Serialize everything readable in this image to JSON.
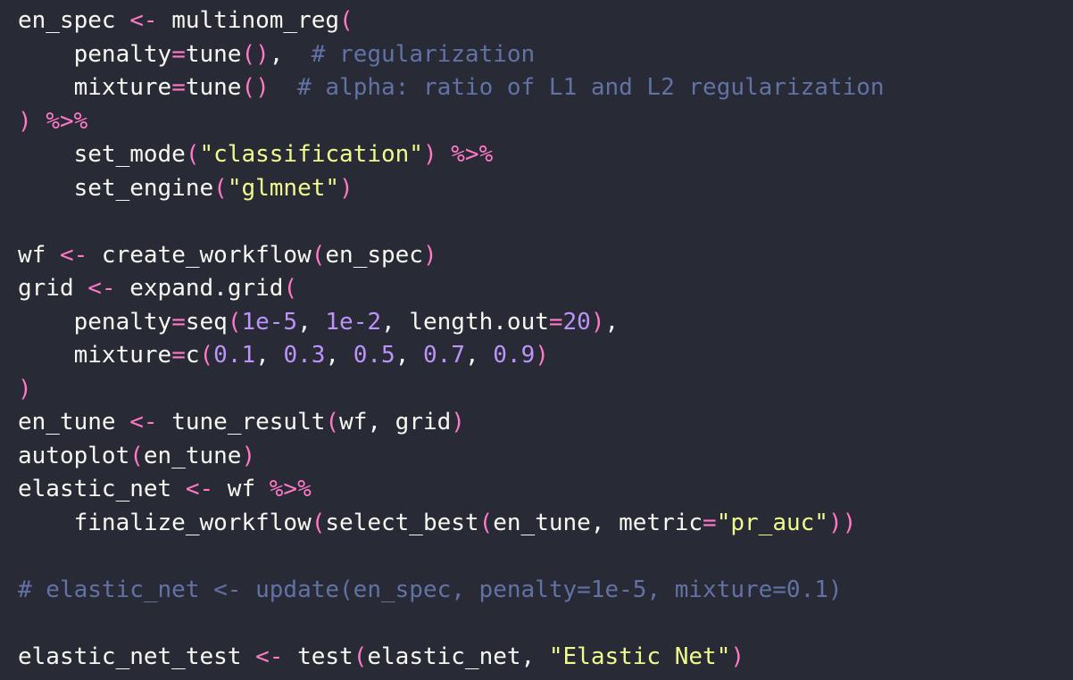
{
  "editor": {
    "background": "#282a36",
    "colors": {
      "plain": "#f8f8f2",
      "operator": "#ff79c6",
      "number": "#bd93f9",
      "string": "#f1fa8c",
      "comment": "#6272a4"
    },
    "lines": [
      [
        [
          "plain",
          "en_spec "
        ],
        [
          "op",
          "<-"
        ],
        [
          "plain",
          " multinom_reg"
        ],
        [
          "paren",
          "("
        ]
      ],
      [
        [
          "plain",
          "    penalty"
        ],
        [
          "op",
          "="
        ],
        [
          "plain",
          "tune"
        ],
        [
          "paren",
          "()"
        ],
        [
          "plain",
          ",  "
        ],
        [
          "comment",
          "# regularization"
        ]
      ],
      [
        [
          "plain",
          "    mixture"
        ],
        [
          "op",
          "="
        ],
        [
          "plain",
          "tune"
        ],
        [
          "paren",
          "()"
        ],
        [
          "plain",
          "  "
        ],
        [
          "comment",
          "# alpha: ratio of L1 and L2 regularization"
        ]
      ],
      [
        [
          "paren",
          ")"
        ],
        [
          "plain",
          " "
        ],
        [
          "op",
          "%>%"
        ]
      ],
      [
        [
          "plain",
          "    set_mode"
        ],
        [
          "paren",
          "("
        ],
        [
          "str",
          "\"classification\""
        ],
        [
          "paren",
          ")"
        ],
        [
          "plain",
          " "
        ],
        [
          "op",
          "%>%"
        ]
      ],
      [
        [
          "plain",
          "    set_engine"
        ],
        [
          "paren",
          "("
        ],
        [
          "str",
          "\"glmnet\""
        ],
        [
          "paren",
          ")"
        ]
      ],
      [],
      [
        [
          "plain",
          "wf "
        ],
        [
          "op",
          "<-"
        ],
        [
          "plain",
          " create_workflow"
        ],
        [
          "paren",
          "("
        ],
        [
          "plain",
          "en_spec"
        ],
        [
          "paren",
          ")"
        ]
      ],
      [
        [
          "plain",
          "grid "
        ],
        [
          "op",
          "<-"
        ],
        [
          "plain",
          " expand.grid"
        ],
        [
          "paren",
          "("
        ]
      ],
      [
        [
          "plain",
          "    penalty"
        ],
        [
          "op",
          "="
        ],
        [
          "plain",
          "seq"
        ],
        [
          "paren",
          "("
        ],
        [
          "num",
          "1e-5"
        ],
        [
          "plain",
          ", "
        ],
        [
          "num",
          "1e-2"
        ],
        [
          "plain",
          ", length.out"
        ],
        [
          "op",
          "="
        ],
        [
          "num",
          "20"
        ],
        [
          "paren",
          ")"
        ],
        [
          "plain",
          ","
        ]
      ],
      [
        [
          "plain",
          "    mixture"
        ],
        [
          "op",
          "="
        ],
        [
          "plain",
          "c"
        ],
        [
          "paren",
          "("
        ],
        [
          "num",
          "0.1"
        ],
        [
          "plain",
          ", "
        ],
        [
          "num",
          "0.3"
        ],
        [
          "plain",
          ", "
        ],
        [
          "num",
          "0.5"
        ],
        [
          "plain",
          ", "
        ],
        [
          "num",
          "0.7"
        ],
        [
          "plain",
          ", "
        ],
        [
          "num",
          "0.9"
        ],
        [
          "paren",
          ")"
        ]
      ],
      [
        [
          "paren",
          ")"
        ]
      ],
      [
        [
          "plain",
          "en_tune "
        ],
        [
          "op",
          "<-"
        ],
        [
          "plain",
          " tune_result"
        ],
        [
          "paren",
          "("
        ],
        [
          "plain",
          "wf, grid"
        ],
        [
          "paren",
          ")"
        ]
      ],
      [
        [
          "plain",
          "autoplot"
        ],
        [
          "paren",
          "("
        ],
        [
          "plain",
          "en_tune"
        ],
        [
          "paren",
          ")"
        ]
      ],
      [
        [
          "plain",
          "elastic_net "
        ],
        [
          "op",
          "<-"
        ],
        [
          "plain",
          " wf "
        ],
        [
          "op",
          "%>%"
        ]
      ],
      [
        [
          "plain",
          "    finalize_workflow"
        ],
        [
          "paren",
          "("
        ],
        [
          "plain",
          "select_best"
        ],
        [
          "paren",
          "("
        ],
        [
          "plain",
          "en_tune, metric"
        ],
        [
          "op",
          "="
        ],
        [
          "str",
          "\"pr_auc\""
        ],
        [
          "paren",
          "))"
        ]
      ],
      [],
      [
        [
          "comment",
          "# elastic_net <- update(en_spec, penalty=1e-5, mixture=0.1)"
        ]
      ],
      [],
      [
        [
          "plain",
          "elastic_net_test "
        ],
        [
          "op",
          "<-"
        ],
        [
          "plain",
          " test"
        ],
        [
          "paren",
          "("
        ],
        [
          "plain",
          "elastic_net, "
        ],
        [
          "str",
          "\"Elastic Net\""
        ],
        [
          "paren",
          ")"
        ]
      ]
    ]
  }
}
